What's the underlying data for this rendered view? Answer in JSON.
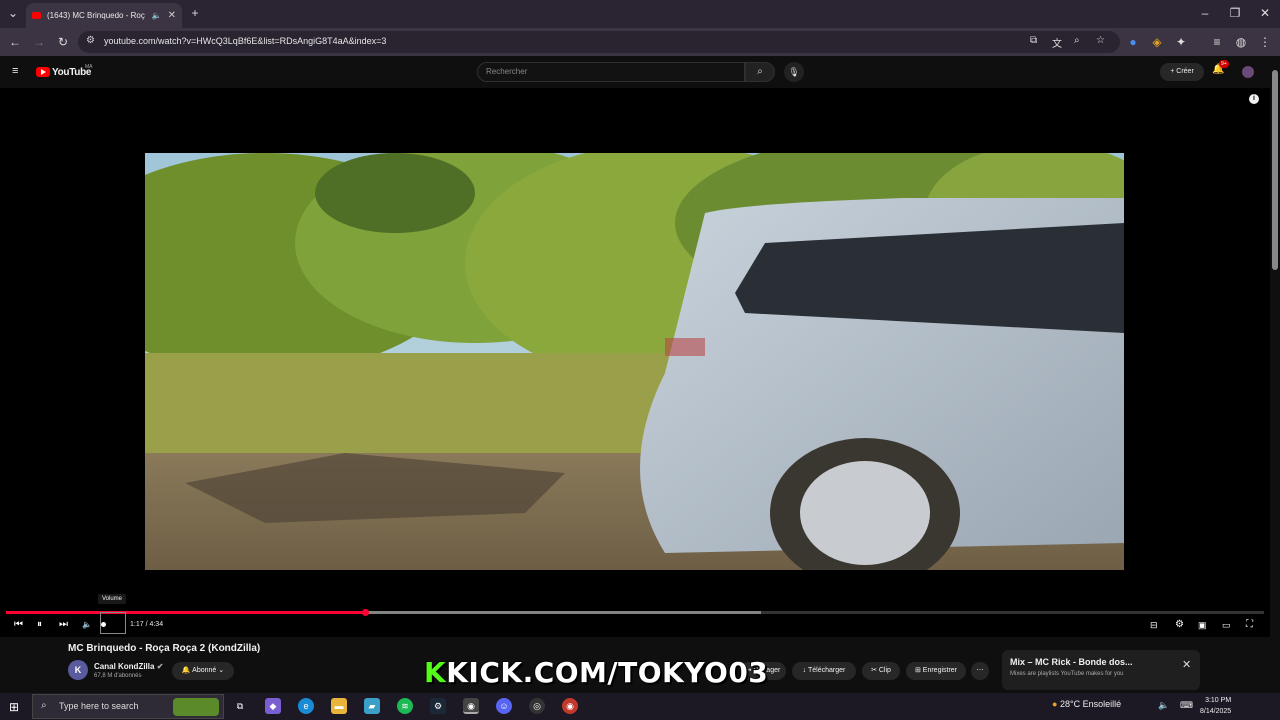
{
  "browser": {
    "tab_title": "(1643) MC Brinquedo - Roç",
    "url": "youtube.com/watch?v=HWcQ3LqBf6E&list=RDsAngiG8T4aA&index=3"
  },
  "youtube": {
    "logo": "YouTube",
    "country_code": "MA",
    "search_placeholder": "Rechercher",
    "create_label": "Créer",
    "notification_count": "9+"
  },
  "player": {
    "current_time": "1:17 / 4:34",
    "volume_tooltip": "Volume",
    "progress_played": 0.285,
    "progress_buffered": 0.6
  },
  "video": {
    "title": "MC Brinquedo - Roça Roça 2 (KondZilla)",
    "channel_name": "Canal KondZilla",
    "channel_avatar": "K",
    "subscribers": "67,8 M d'abonnés",
    "subscribe_label": "Abonné",
    "actions": {
      "share": "Partager",
      "download": "Télécharger",
      "clip": "Clip",
      "save": "Enregistrer"
    }
  },
  "overlay": {
    "kick_k": "K",
    "kick_rest": "KICK.COM/TOKYO03"
  },
  "mix": {
    "title": "Mix – MC Rick - Bonde dos...",
    "subtitle": "Mixes are playlists YouTube makes for you"
  },
  "taskbar": {
    "search_placeholder": "Type here to search",
    "weather": "28°C  Ensoleillé",
    "time": "3:10 PM",
    "date": "8/14/2025"
  },
  "colors": {
    "accent_red": "#ff0033",
    "kick_green": "#53fc18"
  }
}
